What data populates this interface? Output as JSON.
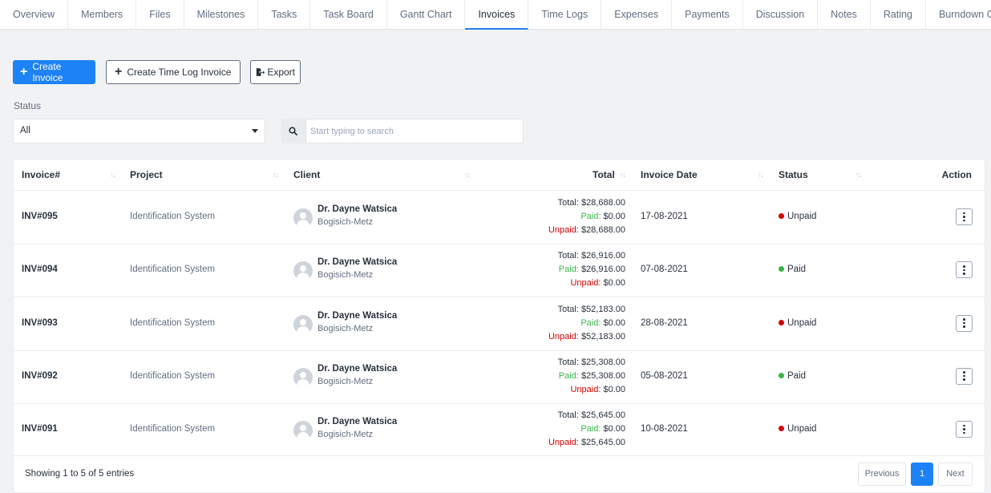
{
  "tabs": [
    {
      "label": "Overview",
      "active": false
    },
    {
      "label": "Members",
      "active": false
    },
    {
      "label": "Files",
      "active": false
    },
    {
      "label": "Milestones",
      "active": false
    },
    {
      "label": "Tasks",
      "active": false
    },
    {
      "label": "Task Board",
      "active": false
    },
    {
      "label": "Gantt Chart",
      "active": false
    },
    {
      "label": "Invoices",
      "active": true
    },
    {
      "label": "Time Logs",
      "active": false
    },
    {
      "label": "Expenses",
      "active": false
    },
    {
      "label": "Payments",
      "active": false
    },
    {
      "label": "Discussion",
      "active": false
    },
    {
      "label": "Notes",
      "active": false
    },
    {
      "label": "Rating",
      "active": false
    },
    {
      "label": "Burndown Chart",
      "active": false
    }
  ],
  "toolbar": {
    "create_invoice": "Create Invoice",
    "create_time_log_invoice": "Create Time Log Invoice",
    "export": "Export"
  },
  "filters": {
    "status_label": "Status",
    "status_value": "All",
    "search_placeholder": "Start typing to search"
  },
  "table": {
    "columns": {
      "invoice": "Invoice#",
      "project": "Project",
      "client": "Client",
      "total": "Total",
      "invoice_date": "Invoice Date",
      "status": "Status",
      "action": "Action"
    },
    "rows": [
      {
        "invoice": "INV#095",
        "project": "Identification System",
        "client_name": "Dr. Dayne Watsica",
        "client_company": "Bogisich-Metz",
        "total_label": "Total:",
        "total": "$28,688.00",
        "paid_label": "Paid:",
        "paid": "$0.00",
        "unpaid_label": "Unpaid:",
        "unpaid": "$28,688.00",
        "date": "17-08-2021",
        "status": "Unpaid",
        "status_color": "#d30000"
      },
      {
        "invoice": "INV#094",
        "project": "Identification System",
        "client_name": "Dr. Dayne Watsica",
        "client_company": "Bogisich-Metz",
        "total_label": "Total:",
        "total": "$26,916.00",
        "paid_label": "Paid:",
        "paid": "$26,916.00",
        "unpaid_label": "Unpaid:",
        "unpaid": "$0.00",
        "date": "07-08-2021",
        "status": "Paid",
        "status_color": "#39b54a"
      },
      {
        "invoice": "INV#093",
        "project": "Identification System",
        "client_name": "Dr. Dayne Watsica",
        "client_company": "Bogisich-Metz",
        "total_label": "Total:",
        "total": "$52,183.00",
        "paid_label": "Paid:",
        "paid": "$0.00",
        "unpaid_label": "Unpaid:",
        "unpaid": "$52,183.00",
        "date": "28-08-2021",
        "status": "Unpaid",
        "status_color": "#d30000"
      },
      {
        "invoice": "INV#092",
        "project": "Identification System",
        "client_name": "Dr. Dayne Watsica",
        "client_company": "Bogisich-Metz",
        "total_label": "Total:",
        "total": "$25,308.00",
        "paid_label": "Paid:",
        "paid": "$25,308.00",
        "unpaid_label": "Unpaid:",
        "unpaid": "$0.00",
        "date": "05-08-2021",
        "status": "Paid",
        "status_color": "#39b54a"
      },
      {
        "invoice": "INV#091",
        "project": "Identification System",
        "client_name": "Dr. Dayne Watsica",
        "client_company": "Bogisich-Metz",
        "total_label": "Total:",
        "total": "$25,645.00",
        "paid_label": "Paid:",
        "paid": "$0.00",
        "unpaid_label": "Unpaid:",
        "unpaid": "$25,645.00",
        "date": "10-08-2021",
        "status": "Unpaid",
        "status_color": "#d30000"
      }
    ]
  },
  "footer": {
    "summary": "Showing 1 to 5 of 5 entries",
    "previous": "Previous",
    "page": "1",
    "next": "Next"
  },
  "colors": {
    "accent": "#1d82f5",
    "paid": "#39b54a",
    "unpaid": "#d30000"
  },
  "icons": {
    "create_invoice": "plus-icon",
    "create_time_log_invoice": "plus-icon",
    "export": "export-file-icon",
    "search": "search-icon",
    "status_select": "caret-down-icon",
    "sort": "sort-arrows-icon",
    "client": "avatar-placeholder-icon",
    "status_dot": "status-dot-icon",
    "action": "kebab-menu-icon"
  }
}
